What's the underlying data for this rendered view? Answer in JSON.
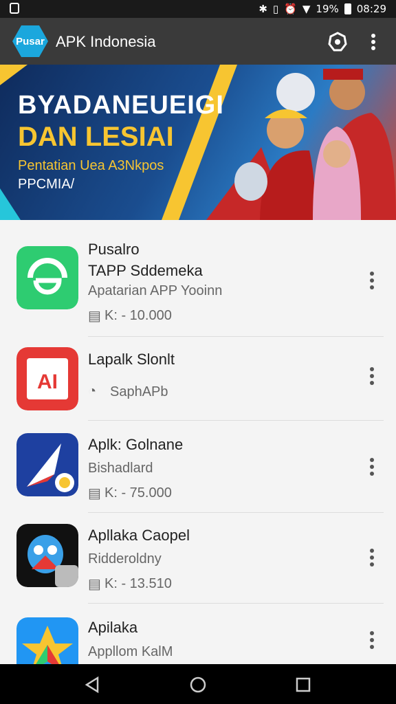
{
  "status_bar": {
    "icons": [
      "bluetooth-icon",
      "vibrate-icon",
      "alarm-icon",
      "wifi-icon"
    ],
    "battery": "19%",
    "time": "08:29"
  },
  "app_bar": {
    "logo_text": "Pusar",
    "title": "APK Indonesia"
  },
  "banner": {
    "line1": "BYADANEUEIGI",
    "line2": "DAN LESIAI",
    "line3": "Pentatian Uea A3Nkpos",
    "line4": "PPCMIA/"
  },
  "apps": [
    {
      "title": "Pusalro",
      "line2": "TAPP Sddemeka",
      "line3": "Apatarian APP Yooinn",
      "meta": "K: - 10.000",
      "icon_color": "#2ecc71"
    },
    {
      "title": "Lapalk Slonlt",
      "line2": "SaphAPb",
      "icon_color": "#e53935"
    },
    {
      "title": "Aplk: Golnane",
      "line2": "Bishadlard",
      "meta": "K: - 75.000",
      "icon_color": "#1e40a0"
    },
    {
      "title": "Apllaka Caopel",
      "line2": "Ridderoldny",
      "meta": "K: - 13.510",
      "icon_color": "#111111"
    },
    {
      "title": "Apilaka",
      "line2": "Appllom KalM",
      "icon_color": "#2196f3"
    }
  ],
  "colors": {
    "status_bar": "#1a1a1a",
    "app_bar": "#3a3a3a",
    "logo": "#1ba7dd",
    "banner_accent": "#f7c531"
  }
}
